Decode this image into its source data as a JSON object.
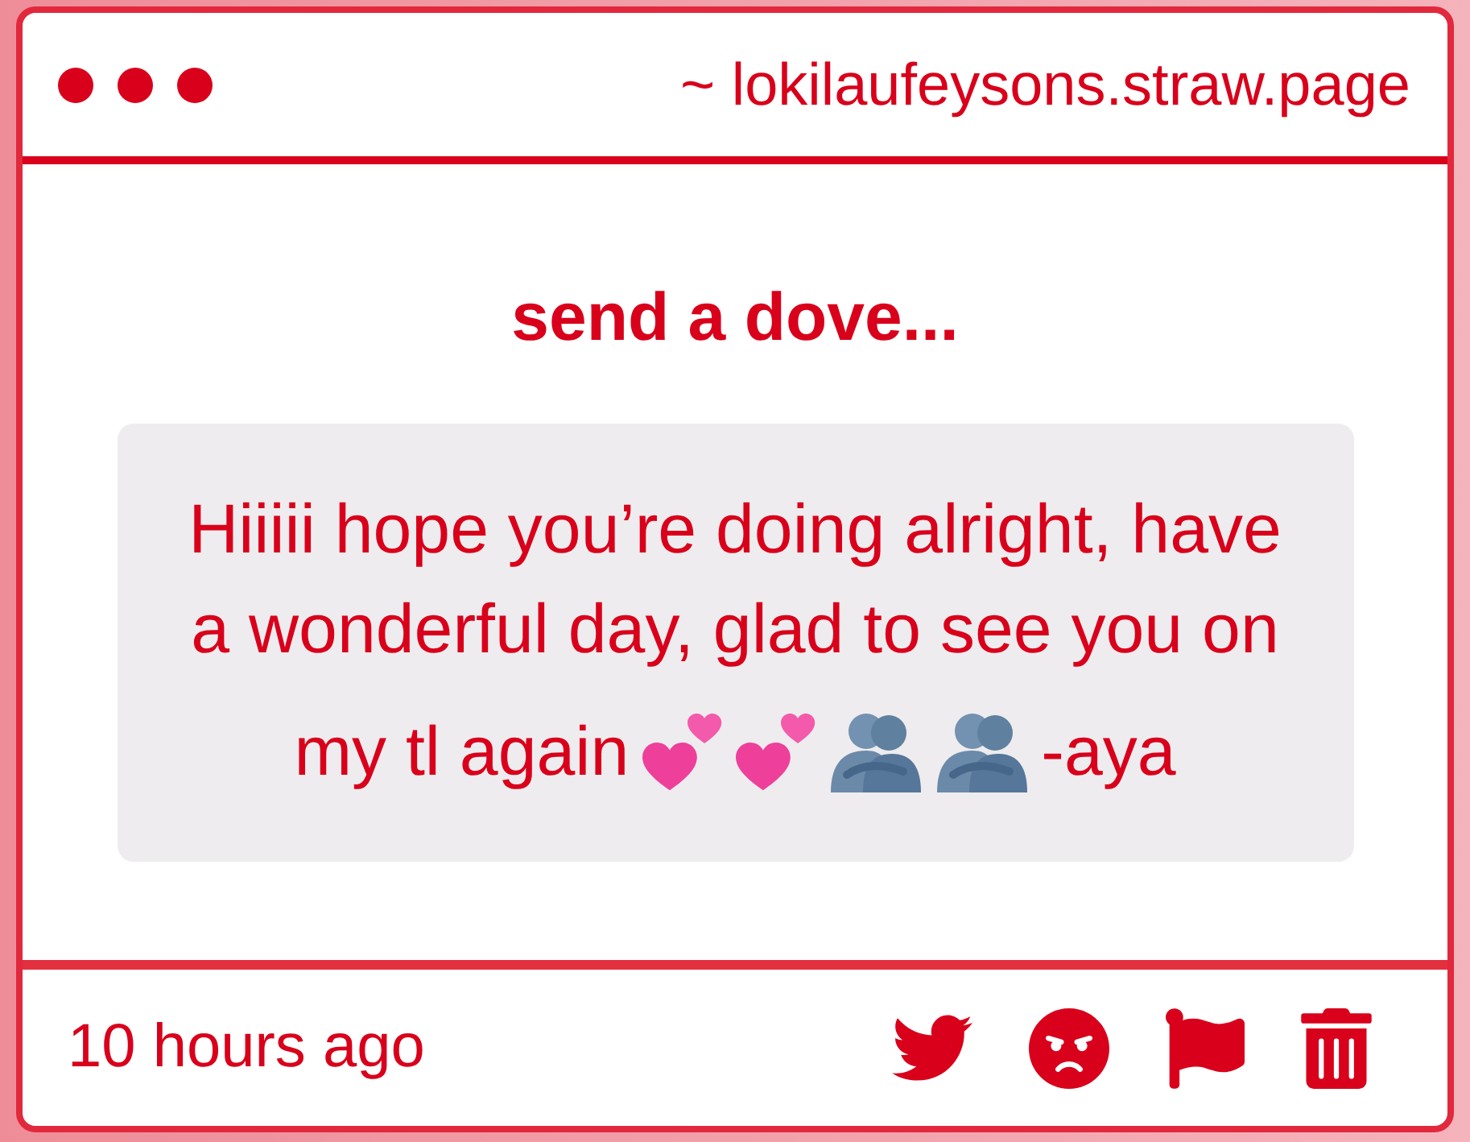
{
  "header": {
    "url": "~ lokilaufeysons.straw.page"
  },
  "title": "send a dove...",
  "message": {
    "body": "Hiiiii hope you’re doing alright, have a wonderful day, glad to see you on",
    "last_line": [
      {
        "kind": "text",
        "text": "my tl again"
      },
      {
        "kind": "hearts"
      },
      {
        "kind": "hearts"
      },
      {
        "kind": "hug"
      },
      {
        "kind": "hug"
      },
      {
        "kind": "text",
        "text": "-aya"
      }
    ]
  },
  "footer": {
    "time": "10 hours ago"
  }
}
